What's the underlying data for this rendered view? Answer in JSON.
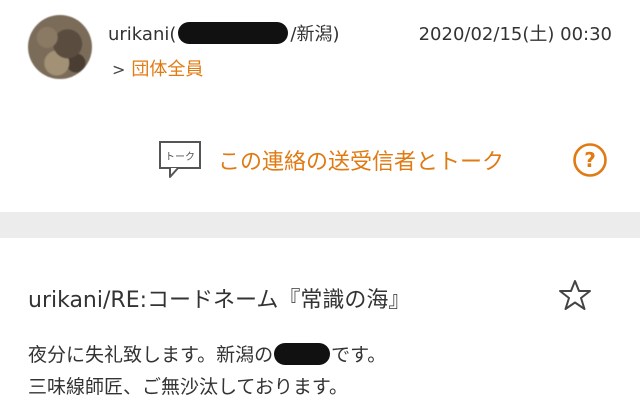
{
  "header": {
    "sender_prefix": "urikani(",
    "sender_suffix": "/新潟)",
    "timestamp": "2020/02/15(土) 00:30",
    "group_label": "団体全員"
  },
  "talk": {
    "icon_text": "トーク",
    "label": "この連絡の送受信者とトーク",
    "help_glyph": "?"
  },
  "message": {
    "subject": "urikani/RE:コードネーム『常識の海』",
    "line1_prefix": "夜分に失礼致します。新潟の",
    "line1_suffix": "です。",
    "line2": "三味線師匠、ご無沙汰しております。"
  },
  "colors": {
    "accent": "#e07a12",
    "text": "#333333",
    "band": "#ececec"
  },
  "icons": [
    "avatar",
    "chevron-right-icon",
    "talk-icon",
    "help-icon",
    "star-icon"
  ]
}
